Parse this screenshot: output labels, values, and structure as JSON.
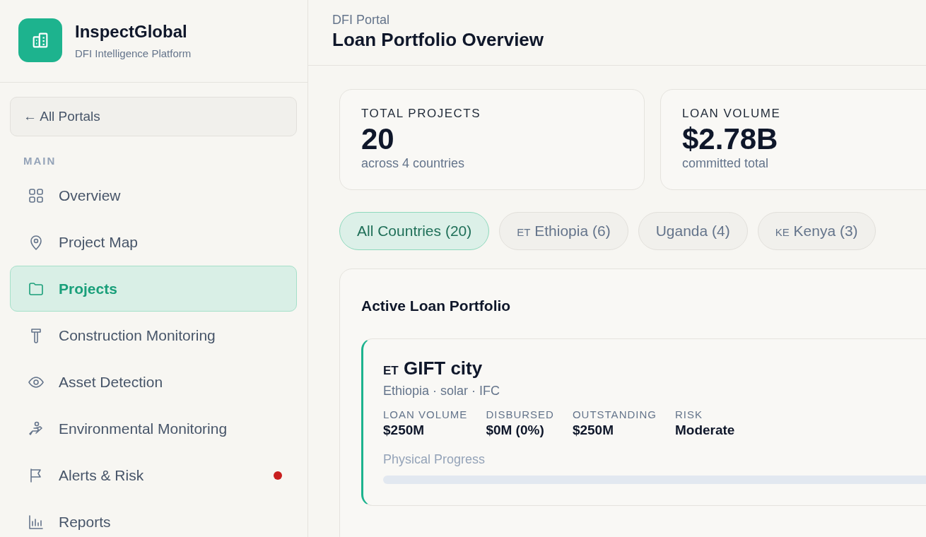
{
  "brand": {
    "name": "InspectGlobal",
    "tagline": "DFI Intelligence Platform"
  },
  "back_button": "← All Portals",
  "sidebar": {
    "section": "MAIN",
    "items": [
      {
        "label": "Overview",
        "selected": false,
        "alert": false
      },
      {
        "label": "Project Map",
        "selected": false,
        "alert": false
      },
      {
        "label": "Projects",
        "selected": true,
        "alert": false
      },
      {
        "label": "Construction Monitoring",
        "selected": false,
        "alert": false
      },
      {
        "label": "Asset Detection",
        "selected": false,
        "alert": false
      },
      {
        "label": "Environmental Monitoring",
        "selected": false,
        "alert": false
      },
      {
        "label": "Alerts & Risk",
        "selected": false,
        "alert": true
      },
      {
        "label": "Reports",
        "selected": false,
        "alert": false
      }
    ]
  },
  "header": {
    "breadcrumb": "DFI Portal",
    "title": "Loan Portfolio Overview"
  },
  "stats": [
    {
      "label": "TOTAL PROJECTS",
      "value": "20",
      "note": "across 4 countries"
    },
    {
      "label": "LOAN VOLUME",
      "value": "$2.78B",
      "note": "committed total"
    }
  ],
  "filters": [
    {
      "label": "All Countries (20)",
      "selected": true
    },
    {
      "flag": "ET",
      "label": "Ethiopia (6)",
      "selected": false
    },
    {
      "label": "Uganda (4)",
      "selected": false
    },
    {
      "flag": "KE",
      "label": "Kenya (3)",
      "selected": false
    }
  ],
  "portfolio": {
    "title": "Active Loan Portfolio",
    "projects": [
      {
        "flag": "ET",
        "name": "GIFT city",
        "meta": "Ethiopia · solar · IFC",
        "metrics": [
          {
            "label": "LOAN VOLUME",
            "value": "$250M"
          },
          {
            "label": "DISBURSED",
            "value": "$0M (0%)"
          },
          {
            "label": "OUTSTANDING",
            "value": "$250M"
          },
          {
            "label": "RISK",
            "value": "Moderate"
          }
        ],
        "progress_label": "Physical Progress",
        "level": 0
      }
    ]
  }
}
